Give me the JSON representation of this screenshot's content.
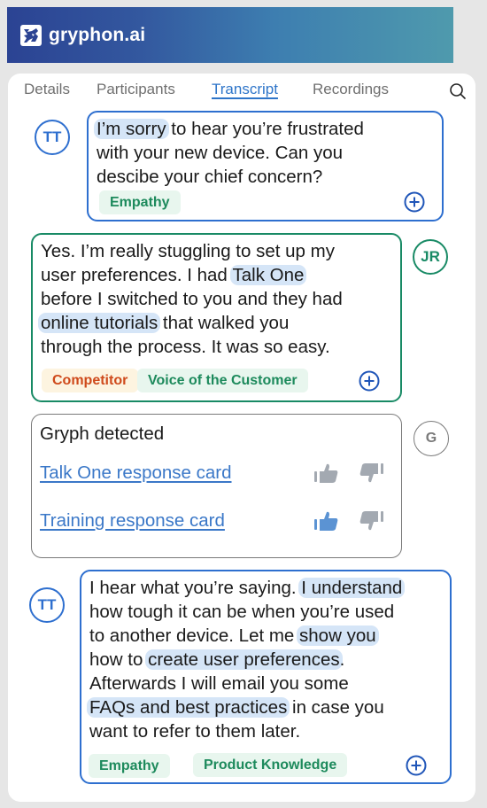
{
  "header": {
    "brand": "gryphon.ai",
    "logo_icon": "gryphon-logo-icon"
  },
  "tabs": [
    {
      "label": "Details",
      "active": false
    },
    {
      "label": "Participants",
      "active": false
    },
    {
      "label": "Transcript",
      "active": true
    },
    {
      "label": "Recordings",
      "active": false
    }
  ],
  "search_icon": "search-icon",
  "messages": [
    {
      "speaker": "TT",
      "side": "agent",
      "lines": [
        [
          {
            "t": "I’m sorry",
            "hl": true
          },
          {
            "t": " to hear you’re frustrated"
          }
        ],
        [
          {
            "t": "with your new device. Can you"
          }
        ],
        [
          {
            "t": "descibe your chief concern?"
          }
        ]
      ],
      "tags": [
        {
          "label": "Empathy",
          "tone": "green"
        }
      ]
    },
    {
      "speaker": "JR",
      "side": "customer",
      "lines": [
        [
          {
            "t": "Yes. I’m really stuggling to set up my"
          }
        ],
        [
          {
            "t": "user preferences. I had "
          },
          {
            "t": "Talk One",
            "hl": true
          }
        ],
        [
          {
            "t": "before I switched to you and they had"
          }
        ],
        [
          {
            "t": "online tutorials",
            "hl": true
          },
          {
            "t": " that walked you"
          }
        ],
        [
          {
            "t": "through the process. It was so easy."
          }
        ]
      ],
      "tags": [
        {
          "label": "Competitor",
          "tone": "orange"
        },
        {
          "label": "Voice of the Customer",
          "tone": "green"
        }
      ]
    },
    {
      "speaker": "G",
      "side": "gryph",
      "title": "Gryph detected",
      "cards": [
        {
          "label": "Talk One response card",
          "thumbs_up": false,
          "thumbs_down": false
        },
        {
          "label": "Training response card",
          "thumbs_up": true,
          "thumbs_down": false
        }
      ]
    },
    {
      "speaker": "TT",
      "side": "agent",
      "lines": [
        [
          {
            "t": "I hear what you’re saying. "
          },
          {
            "t": "I understand",
            "hl": true
          }
        ],
        [
          {
            "t": "how tough it can be when you’re used"
          }
        ],
        [
          {
            "t": "to another device. Let me "
          },
          {
            "t": "show you",
            "hl": true
          }
        ],
        [
          {
            "t": "how to "
          },
          {
            "t": "create user preferences",
            "hl": true
          },
          {
            "t": "."
          }
        ],
        [
          {
            "t": "Afterwards I will email you some"
          }
        ],
        [
          {
            "t": "FAQs and best practices",
            "hl": true
          },
          {
            "t": " in case you"
          }
        ],
        [
          {
            "t": "want to refer to them later."
          }
        ]
      ],
      "tags": [
        {
          "label": "Empathy",
          "tone": "green"
        },
        {
          "label": "Product Knowledge",
          "tone": "green"
        }
      ]
    }
  ],
  "colors": {
    "agent": "#2e6fcf",
    "customer": "#188a65",
    "gryph": "#7a7a7a",
    "highlight": "#d5e5f7",
    "link": "#3b78c8",
    "thumb_active": "#5b93d3",
    "thumb_inactive": "#a3a9b1"
  }
}
